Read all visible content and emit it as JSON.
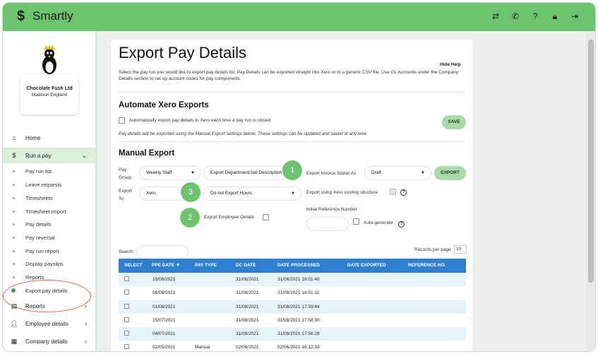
{
  "app": {
    "name": "Smartly"
  },
  "topbar": {
    "icons": [
      "transfer-icon",
      "phone-icon",
      "help-icon",
      "lock-icon",
      "logout-icon"
    ]
  },
  "company": {
    "name": "Chocolate Fush Ltd",
    "subtitle": "Madison England"
  },
  "nav": {
    "home": "Home",
    "run_a_pay": "Run a pay",
    "sub_items": [
      "Pay run list",
      "Leave requests",
      "Timesheets",
      "Timesheet import",
      "Pay details",
      "Pay reversal",
      "Pay run report",
      "Display payslips",
      "Reports",
      "Export pay details"
    ],
    "reports": "Reports",
    "employee_details": "Employee details",
    "company_details": "Company details"
  },
  "page": {
    "title": "Export Pay Details",
    "hide_help": "Hide Help",
    "intro": "Select the pay run you would like to export pay details for. Pay Details can be exported straight into Xero or to a generic CSV file. Use GL Accounts under the Company Details section to set up account codes for pay components."
  },
  "automate": {
    "heading": "Automate Xero Exports",
    "checkbox_label": "Automatically export pay details to Xero each time a pay run is closed.",
    "note": "Pay details will be exported using the Manual Export settings below. These settings can be updated and saved at any time.",
    "save_label": "SAVE"
  },
  "manual": {
    "heading": "Manual Export",
    "pay_group_label_1": "Pay",
    "pay_group_label_2": "Group",
    "pay_group_value": "Weekly Staff",
    "dept_value": "Export Department/Job Description",
    "invoice_status_label": "Export Invoice Status As",
    "invoice_status_value": "Draft",
    "export_label": "EXPORT",
    "export_to_label_1": "Export",
    "export_to_label_2": "To",
    "export_to_value": "Xero",
    "hours_value": "Do not Export Hours",
    "costing_label": "Export using Xero costing structure",
    "employee_details_label": "Export Employee Details",
    "initial_ref_label": "Initial Reference Number",
    "auto_generate_label": "Auto-generate",
    "badges": [
      "1",
      "2",
      "3"
    ]
  },
  "table_controls": {
    "search_label": "Search:",
    "records_label": "Records per page",
    "records_value": "10"
  },
  "table": {
    "columns": [
      "SELECT",
      "PPE DATE ▼",
      "PAY TYPE",
      "DC DATE",
      "DATE PROCESSED",
      "DATE EXPORTED",
      "REFERENCE NO."
    ],
    "rows": [
      [
        "15/08/2021",
        "",
        "31/08/2021",
        "31/08/2021 18:01:40",
        "",
        ""
      ],
      [
        "08/08/2021",
        "",
        "31/08/2021",
        "31/08/2021 18:01:11",
        "",
        ""
      ],
      [
        "01/08/2021",
        "",
        "31/08/2021",
        "31/08/2021 17:59:44",
        "",
        ""
      ],
      [
        "25/07/2021",
        "",
        "31/08/2021",
        "31/08/2021 17:58:30",
        "",
        ""
      ],
      [
        "04/07/2021",
        "",
        "31/08/2021",
        "31/08/2021 17:56:28",
        "",
        ""
      ],
      [
        "02/05/2021",
        "Manual",
        "02/06/2021",
        "02/06/2021 16:12:33",
        "",
        ""
      ]
    ]
  },
  "colors": {
    "brand": "#6cc56e",
    "table_header": "#2f7fd0",
    "row_alt": "#e6f3fb"
  }
}
